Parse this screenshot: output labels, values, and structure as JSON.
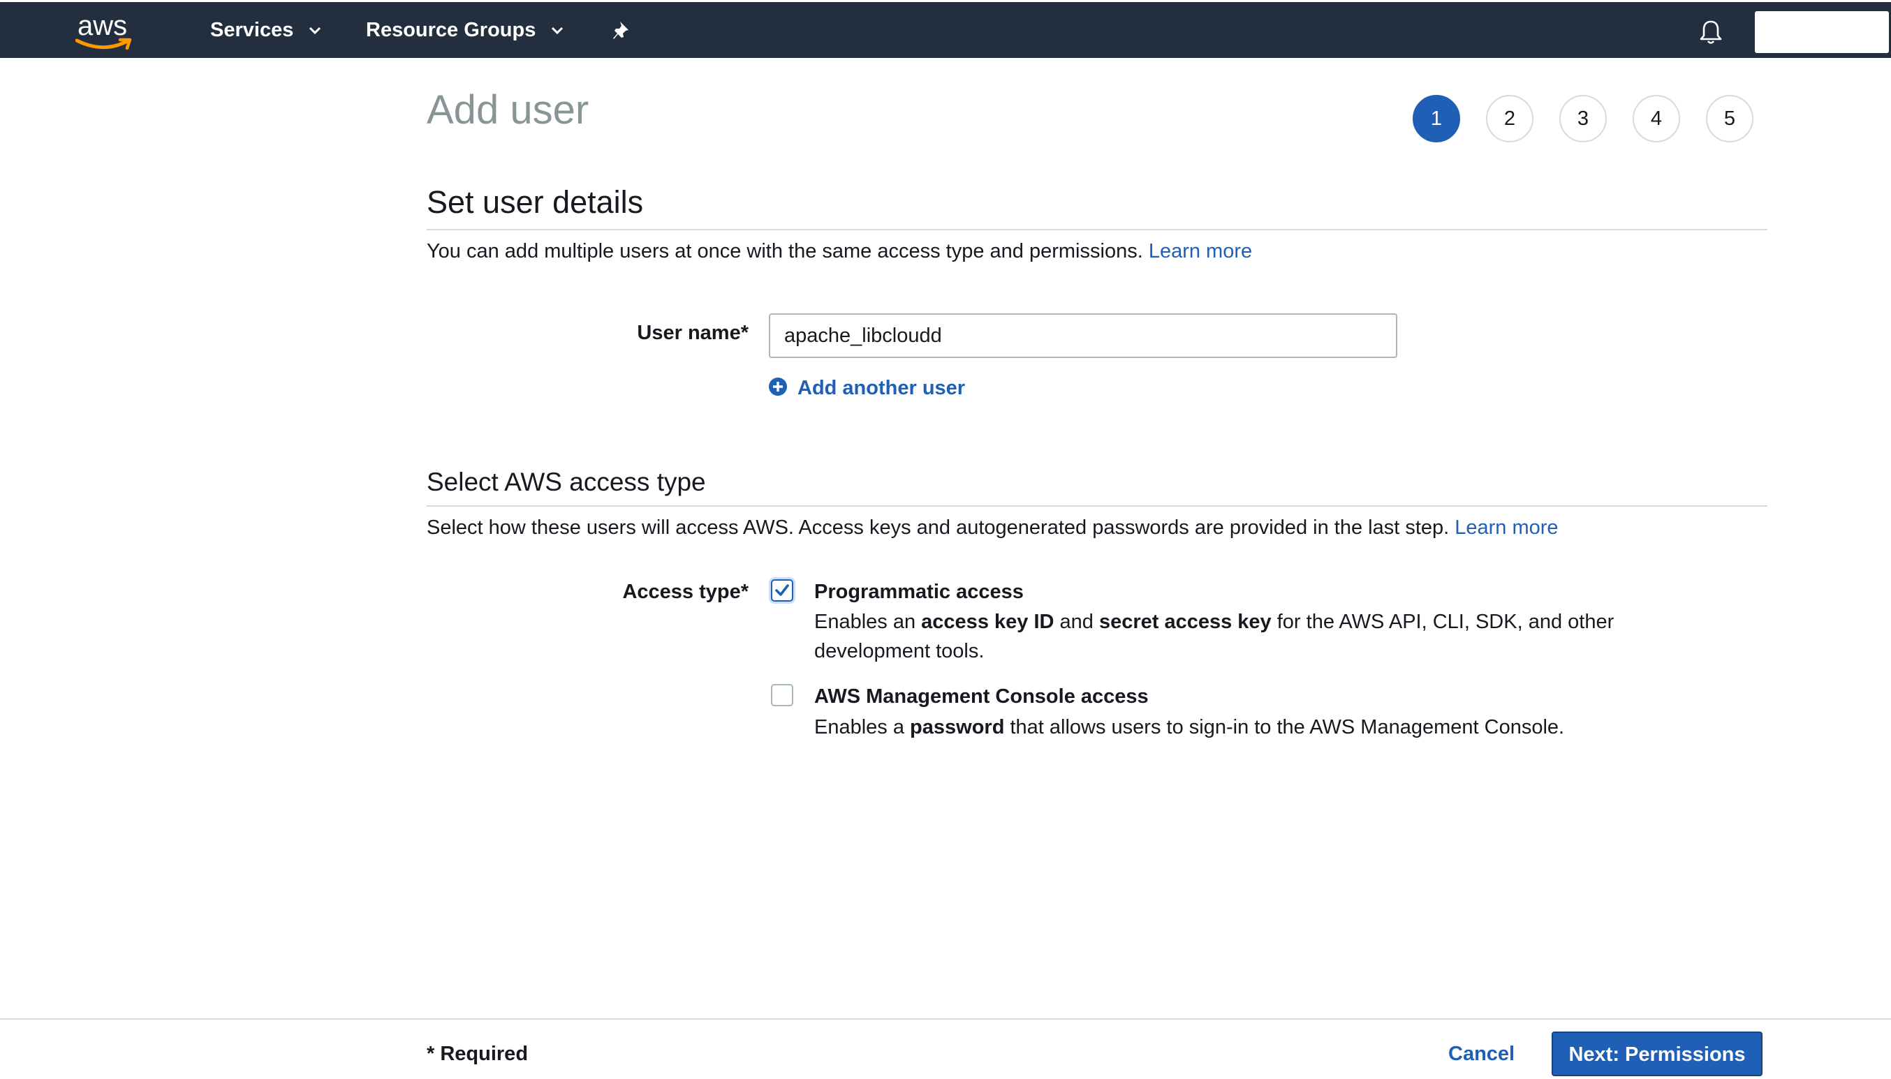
{
  "nav": {
    "logo_text": "aws",
    "services_label": "Services",
    "resource_groups_label": "Resource Groups",
    "pin_icon": "pin-icon",
    "bell_icon": "bell-icon"
  },
  "page": {
    "title": "Add user",
    "steps": [
      "1",
      "2",
      "3",
      "4",
      "5"
    ],
    "active_step": 1
  },
  "user_details": {
    "heading": "Set user details",
    "description": "You can add multiple users at once with the same access type and permissions.",
    "learn_more": "Learn more",
    "username_label": "User name*",
    "username_value": "apache_libcloudd",
    "add_another_user": "Add another user"
  },
  "access_type": {
    "heading": "Select AWS access type",
    "description": "Select how these users will access AWS. Access keys and autogenerated passwords are provided in the last step.",
    "learn_more": "Learn more",
    "label": "Access type*",
    "options": [
      {
        "title": "Programmatic access",
        "checked": true,
        "desc_parts": [
          "Enables an ",
          "access key ID",
          " and ",
          "secret access key",
          " for the AWS API, CLI, SDK, and other development tools."
        ]
      },
      {
        "title": "AWS Management Console access",
        "checked": false,
        "desc_parts": [
          "Enables a ",
          "password",
          " that allows users to sign-in to the AWS Management Console."
        ]
      }
    ]
  },
  "footer": {
    "required_note": "* Required",
    "cancel_label": "Cancel",
    "next_label": "Next: Permissions"
  },
  "colors": {
    "nav_bg": "#232f3e",
    "accent": "#1f5fb5",
    "logo_smile": "#ff9900"
  }
}
